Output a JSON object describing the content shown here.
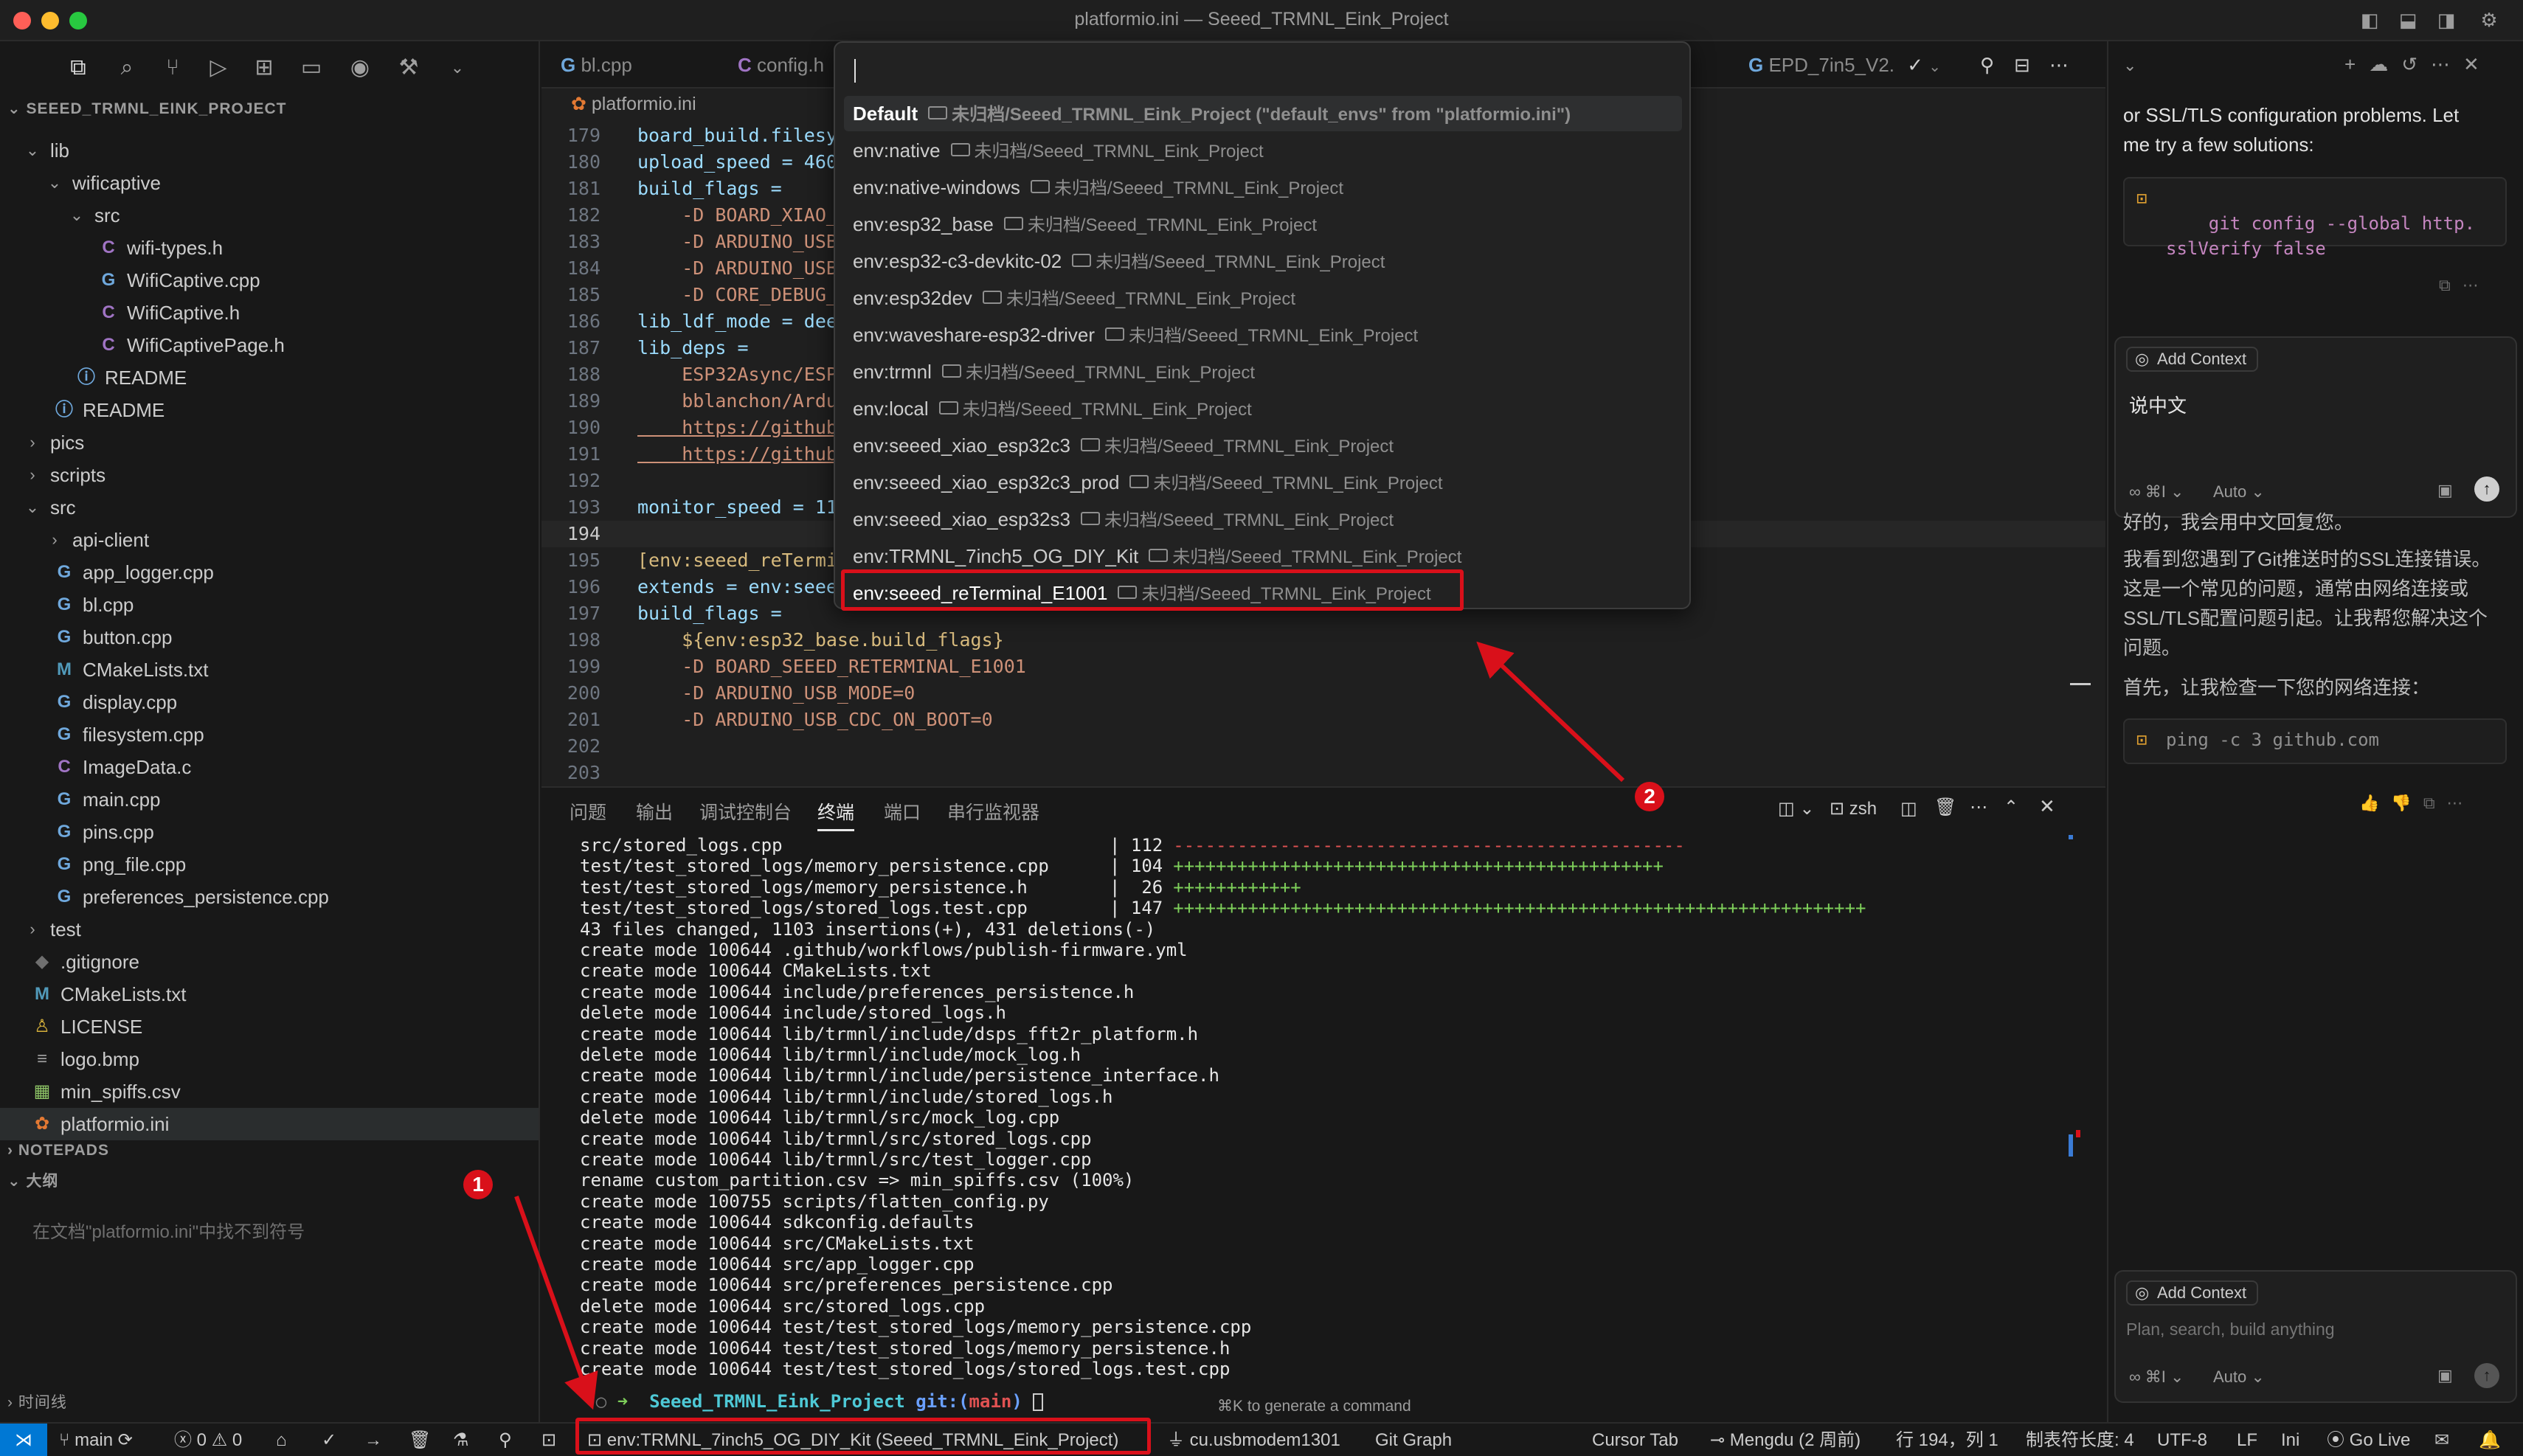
{
  "window": {
    "title": "platformio.ini — Seeed_TRMNL_Eink_Project"
  },
  "explorer": {
    "project_name": "SEEED_TRMNL_EINK_PROJECT",
    "items": [
      {
        "label": "lib",
        "depth": 0,
        "kind": "folder-open"
      },
      {
        "label": "wificaptive",
        "depth": 1,
        "kind": "folder-open"
      },
      {
        "label": "src",
        "depth": 2,
        "kind": "folder-open"
      },
      {
        "label": "wifi-types.h",
        "depth": 3,
        "kind": "c",
        "icon": "C"
      },
      {
        "label": "WifiCaptive.cpp",
        "depth": 3,
        "kind": "cpp",
        "icon": "G"
      },
      {
        "label": "WifiCaptive.h",
        "depth": 3,
        "kind": "c",
        "icon": "C"
      },
      {
        "label": "WifiCaptivePage.h",
        "depth": 3,
        "kind": "c",
        "icon": "C"
      },
      {
        "label": "README",
        "depth": 2,
        "kind": "info",
        "icon": "ⓘ"
      },
      {
        "label": "README",
        "depth": 1,
        "kind": "info",
        "icon": "ⓘ"
      },
      {
        "label": "pics",
        "depth": 0,
        "kind": "folder"
      },
      {
        "label": "scripts",
        "depth": 0,
        "kind": "folder"
      },
      {
        "label": "src",
        "depth": 0,
        "kind": "folder-open"
      },
      {
        "label": "api-client",
        "depth": 1,
        "kind": "folder"
      },
      {
        "label": "app_logger.cpp",
        "depth": 1,
        "kind": "cpp",
        "icon": "G"
      },
      {
        "label": "bl.cpp",
        "depth": 1,
        "kind": "cpp",
        "icon": "G"
      },
      {
        "label": "button.cpp",
        "depth": 1,
        "kind": "cpp",
        "icon": "G"
      },
      {
        "label": "CMakeLists.txt",
        "depth": 1,
        "kind": "cmake",
        "icon": "M"
      },
      {
        "label": "display.cpp",
        "depth": 1,
        "kind": "cpp",
        "icon": "G"
      },
      {
        "label": "filesystem.cpp",
        "depth": 1,
        "kind": "cpp",
        "icon": "G"
      },
      {
        "label": "ImageData.c",
        "depth": 1,
        "kind": "c",
        "icon": "C"
      },
      {
        "label": "main.cpp",
        "depth": 1,
        "kind": "cpp",
        "icon": "G"
      },
      {
        "label": "pins.cpp",
        "depth": 1,
        "kind": "cpp",
        "icon": "G"
      },
      {
        "label": "png_file.cpp",
        "depth": 1,
        "kind": "cpp",
        "icon": "G"
      },
      {
        "label": "preferences_persistence.cpp",
        "depth": 1,
        "kind": "cpp",
        "icon": "G"
      },
      {
        "label": "test",
        "depth": 0,
        "kind": "folder"
      },
      {
        "label": ".gitignore",
        "depth": 0,
        "kind": "git",
        "icon": "◆"
      },
      {
        "label": "CMakeLists.txt",
        "depth": 0,
        "kind": "cmake",
        "icon": "M"
      },
      {
        "label": "LICENSE",
        "depth": 0,
        "kind": "license",
        "icon": "♙"
      },
      {
        "label": "logo.bmp",
        "depth": 0,
        "kind": "image",
        "icon": "≡"
      },
      {
        "label": "min_spiffs.csv",
        "depth": 0,
        "kind": "csv",
        "icon": "▦"
      },
      {
        "label": "platformio.ini",
        "depth": 0,
        "kind": "pio",
        "icon": "✿",
        "selected": true
      }
    ],
    "notepads": "NOTEPADS",
    "outline": "大纲",
    "outline_empty": "在文档\"platformio.ini\"中找不到符号",
    "timeline": "时间线"
  },
  "editor": {
    "tabs": [
      {
        "label": "bl.cpp",
        "icon": "G"
      },
      {
        "label": "config.h",
        "icon": "C"
      },
      {
        "label": "EPD_7in5_V2.",
        "icon": "G"
      }
    ],
    "breadcrumb": "platformio.ini",
    "lines": [
      {
        "n": "179",
        "text": "board_build.filesys"
      },
      {
        "n": "180",
        "text": "upload_speed = 4608"
      },
      {
        "n": "181",
        "text": "build_flags ="
      },
      {
        "n": "182",
        "text": "    -D BOARD_XIAO_E"
      },
      {
        "n": "183",
        "text": "    -D ARDUINO_USB_"
      },
      {
        "n": "184",
        "text": "    -D ARDUINO_USB_"
      },
      {
        "n": "185",
        "text": "    -D CORE_DEBUG_L"
      },
      {
        "n": "186",
        "text": "lib_ldf_mode = deep"
      },
      {
        "n": "187",
        "text": "lib_deps ="
      },
      {
        "n": "188",
        "text": "    ESP32Async/ESPA"
      },
      {
        "n": "189",
        "text": "    bblanchon/Ardui"
      },
      {
        "n": "190",
        "text": "    https://github."
      },
      {
        "n": "191",
        "text": "    https://github."
      },
      {
        "n": "192",
        "text": ""
      },
      {
        "n": "193",
        "text": "monitor_speed = 115"
      },
      {
        "n": "194",
        "text": ""
      },
      {
        "n": "195",
        "text": "[env:seeed_reTermin"
      },
      {
        "n": "196",
        "text": "extends = env:seeed"
      },
      {
        "n": "197",
        "text": "build_flags ="
      },
      {
        "n": "198",
        "text": "    ${env:esp32_base.build_flags}"
      },
      {
        "n": "199",
        "text": "    -D BOARD_SEEED_RETERMINAL_E1001"
      },
      {
        "n": "200",
        "text": "    -D ARDUINO_USB_MODE=0"
      },
      {
        "n": "201",
        "text": "    -D ARDUINO_USB_CDC_ON_BOOT=0"
      },
      {
        "n": "202",
        "text": ""
      },
      {
        "n": "203",
        "text": ""
      }
    ]
  },
  "quick_pick": {
    "input_value": "",
    "items": [
      {
        "label": "Default",
        "desc": "未归档/Seeed_TRMNL_Eink_Project (\"default_envs\" from \"platformio.ini\")"
      },
      {
        "label": "env:native",
        "desc": "未归档/Seeed_TRMNL_Eink_Project"
      },
      {
        "label": "env:native-windows",
        "desc": "未归档/Seeed_TRMNL_Eink_Project"
      },
      {
        "label": "env:esp32_base",
        "desc": "未归档/Seeed_TRMNL_Eink_Project"
      },
      {
        "label": "env:esp32-c3-devkitc-02",
        "desc": "未归档/Seeed_TRMNL_Eink_Project"
      },
      {
        "label": "env:esp32dev",
        "desc": "未归档/Seeed_TRMNL_Eink_Project"
      },
      {
        "label": "env:waveshare-esp32-driver",
        "desc": "未归档/Seeed_TRMNL_Eink_Project"
      },
      {
        "label": "env:trmnl",
        "desc": "未归档/Seeed_TRMNL_Eink_Project"
      },
      {
        "label": "env:local",
        "desc": "未归档/Seeed_TRMNL_Eink_Project"
      },
      {
        "label": "env:seeed_xiao_esp32c3",
        "desc": "未归档/Seeed_TRMNL_Eink_Project"
      },
      {
        "label": "env:seeed_xiao_esp32c3_prod",
        "desc": "未归档/Seeed_TRMNL_Eink_Project"
      },
      {
        "label": "env:seeed_xiao_esp32s3",
        "desc": "未归档/Seeed_TRMNL_Eink_Project"
      },
      {
        "label": "env:TRMNL_7inch5_OG_DIY_Kit",
        "desc": "未归档/Seeed_TRMNL_Eink_Project"
      },
      {
        "label": "env:seeed_reTerminal_E1001",
        "desc": "未归档/Seeed_TRMNL_Eink_Project",
        "highlighted": true
      }
    ]
  },
  "panel": {
    "tabs": [
      "问题",
      "输出",
      "调试控制台",
      "终端",
      "端口",
      "串行监视器"
    ],
    "active_tab": "终端",
    "shell": "zsh",
    "stat_lines": [
      {
        "file": "src/stored_logs.cpp",
        "count": "112",
        "bar": "------------------------------------------------",
        "color": "#e05252"
      },
      {
        "file": "test/test_stored_logs/memory_persistence.cpp",
        "count": "104",
        "bar": "++++++++++++++++++++++++++++++++++++++++++++++",
        "color": "#7ecf5a"
      },
      {
        "file": "test/test_stored_logs/memory_persistence.h",
        "count": " 26",
        "bar": "++++++++++++",
        "color": "#7ecf5a"
      },
      {
        "file": "test/test_stored_logs/stored_logs.test.cpp",
        "count": "147",
        "bar": "+++++++++++++++++++++++++++++++++++++++++++++++++++++++++++++++++",
        "color": "#7ecf5a"
      }
    ],
    "lines": [
      "43 files changed, 1103 insertions(+), 431 deletions(-)",
      "create mode 100644 .github/workflows/publish-firmware.yml",
      "create mode 100644 CMakeLists.txt",
      "create mode 100644 include/preferences_persistence.h",
      "delete mode 100644 include/stored_logs.h",
      "create mode 100644 lib/trmnl/include/dsps_fft2r_platform.h",
      "delete mode 100644 lib/trmnl/include/mock_log.h",
      "create mode 100644 lib/trmnl/include/persistence_interface.h",
      "create mode 100644 lib/trmnl/include/stored_logs.h",
      "delete mode 100644 lib/trmnl/src/mock_log.cpp",
      "create mode 100644 lib/trmnl/src/stored_logs.cpp",
      "create mode 100644 lib/trmnl/src/test_logger.cpp",
      "rename custom_partition.csv => min_spiffs.csv (100%)",
      "create mode 100755 scripts/flatten_config.py",
      "create mode 100644 sdkconfig.defaults",
      "create mode 100644 src/CMakeLists.txt",
      "create mode 100644 src/app_logger.cpp",
      "create mode 100644 src/preferences_persistence.cpp",
      "delete mode 100644 src/stored_logs.cpp",
      "create mode 100644 test/test_stored_logs/memory_persistence.cpp",
      "create mode 100644 test/test_stored_logs/memory_persistence.h",
      "create mode 100644 test/test_stored_logs/stored_logs.test.cpp"
    ],
    "prompt_dir": "Seeed_TRMNL_Eink_Project",
    "prompt_git": "git:(",
    "prompt_branch": "main",
    "prompt_close": ")",
    "hint": "⌘K to generate a command"
  },
  "chat": {
    "intro_lines": [
      "or SSL/TLS configuration problems. Let",
      "me try a few solutions:"
    ],
    "code1": "git config --global http.\nsslVerify false",
    "context_label": "Add Context",
    "user_message": "说中文",
    "mode": "Auto",
    "reply_1": "好的，我会用中文回复您。",
    "reply_2": "我看到您遇到了Git推送时的SSL连接错误。这是一个常见的问题，通常由网络连接或SSL/TLS配置问题引起。让我帮您解决这个问题。",
    "reply_3": "首先，让我检查一下您的网络连接：",
    "code2": "ping -c 3 github.com",
    "input_placeholder": "Plan, search, build anything",
    "mode2": "Auto"
  },
  "statusbar": {
    "branch": "main",
    "errors": "0",
    "warnings": "0",
    "env": "env:TRMNL_7inch5_OG_DIY_Kit (Seeed_TRMNL_Eink_Project)",
    "port": "cu.usbmodem1301",
    "git_graph": "Git Graph",
    "cursor_tab": "Cursor Tab",
    "author": "Mengdu (2 周前)",
    "position": "行 194，列 1",
    "tab_size": "制表符长度: 4",
    "encoding": "UTF-8",
    "eol": "LF",
    "lang": "Ini",
    "go_live": "Go Live"
  },
  "annotations": [
    "1",
    "2"
  ],
  "colors": {
    "accent": "#0078d4",
    "annotation": "#d9101a",
    "cpp_icon": "#6fa8dc",
    "c_icon": "#a074c4",
    "cmake_icon": "#519aba",
    "selection": "#2a2d2e"
  }
}
